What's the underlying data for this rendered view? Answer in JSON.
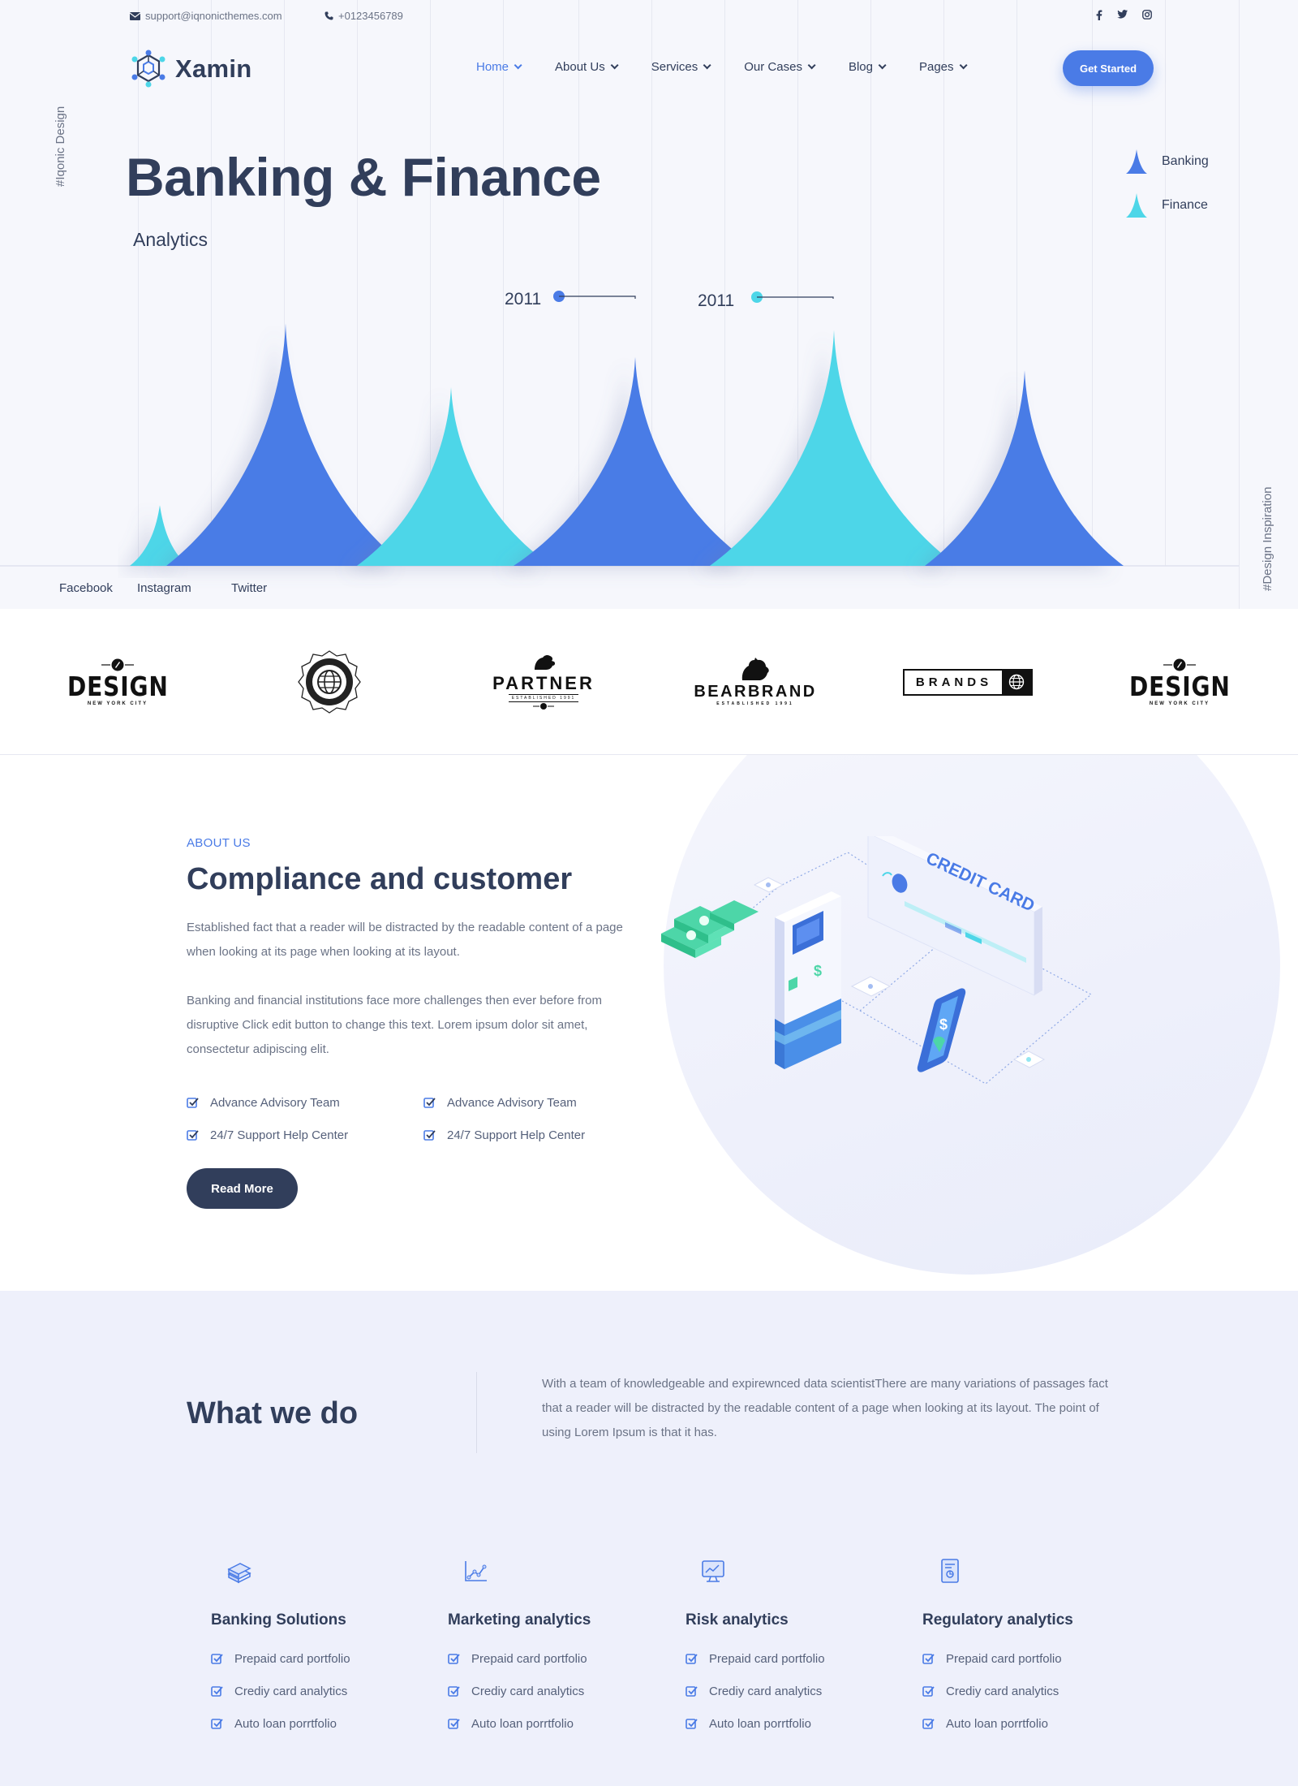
{
  "topbar": {
    "email": "support@iqnonicthemes.com",
    "phone": "+0123456789",
    "social_icons": [
      "facebook-icon",
      "twitter-icon",
      "instagram-icon"
    ]
  },
  "brand": {
    "name": "Xamin"
  },
  "nav": {
    "items": [
      {
        "label": "Home",
        "active": true
      },
      {
        "label": "About Us"
      },
      {
        "label": "Services"
      },
      {
        "label": "Our Cases"
      },
      {
        "label": "Blog"
      },
      {
        "label": "Pages"
      }
    ],
    "cta": "Get Started"
  },
  "hero": {
    "side_left": "#Iqonic Design",
    "side_right": "#Design Inspiration",
    "title": "Banking & Finance",
    "subtitle": "Analytics",
    "legend": [
      {
        "label": "Banking",
        "color": "#4a7be6"
      },
      {
        "label": "Finance",
        "color": "#4dd6e8"
      }
    ],
    "annotations": [
      {
        "label": "2011",
        "color": "#4a7be6"
      },
      {
        "label": "2011",
        "color": "#4dd6e8"
      }
    ],
    "social_links": [
      "Facebook",
      "Instagram",
      "Twitter"
    ]
  },
  "chart_data": {
    "type": "area",
    "title": "Analytics",
    "series": [
      {
        "name": "Banking",
        "color": "#4a7be6",
        "values": [
          0.72,
          0.62,
          0.58
        ]
      },
      {
        "name": "Finance",
        "color": "#4dd6e8",
        "values": [
          0.18,
          0.53,
          0.7
        ]
      }
    ],
    "annotations": [
      "2011",
      "2011"
    ],
    "grid": true,
    "legend": "top-right"
  },
  "brands": [
    {
      "name": "DESIGN",
      "sub": "NEW YORK CITY"
    },
    {
      "name": "globe-seal"
    },
    {
      "name": "PARTNER",
      "sub": "ESTABLISHED 1991"
    },
    {
      "name": "BEARBRAND",
      "sub": "ESTABLISHED 1991"
    },
    {
      "name": "BRANDS"
    },
    {
      "name": "DESIGN",
      "sub": "NEW YORK CITY"
    }
  ],
  "about": {
    "kicker": "ABOUT US",
    "title": "Compliance and customer",
    "p1": "Established fact that a reader will be distracted by the readable content of a page when looking at its page when looking at its layout.",
    "p2": "Banking and financial institutions face more challenges then ever before from disruptive Click edit button to change this text. Lorem ipsum dolor sit amet, consectetur adipiscing elit.",
    "checks": [
      "Advance Advisory Team",
      "Advance Advisory Team",
      "24/7 Support Help Center",
      "24/7 Support Help Center"
    ],
    "button": "Read More",
    "illustration": {
      "card_text": "CREDIT CARD",
      "symbol": "$"
    }
  },
  "what": {
    "title": "What we do",
    "para": "With a team of knowledgeable and expirewnced data scientistThere are many variations of passages fact that a reader will be distracted by the readable content of a page when looking at its layout. The point of using Lorem Ipsum is that it has.",
    "services": [
      {
        "title": "Banking Solutions",
        "icon": "money-stack-icon",
        "items": [
          "Prepaid card portfolio",
          "Crediy card analytics",
          "Auto loan porrtfolio"
        ]
      },
      {
        "title": "Marketing analytics",
        "icon": "line-chart-icon",
        "items": [
          "Prepaid card portfolio",
          "Crediy card analytics",
          "Auto loan porrtfolio"
        ]
      },
      {
        "title": "Risk analytics",
        "icon": "monitor-analytics-icon",
        "items": [
          "Prepaid card portfolio",
          "Crediy card analytics",
          "Auto loan porrtfolio"
        ]
      },
      {
        "title": "Regulatory analytics",
        "icon": "document-report-icon",
        "items": [
          "Prepaid card portfolio",
          "Crediy card analytics",
          "Auto loan porrtfolio"
        ]
      }
    ]
  }
}
